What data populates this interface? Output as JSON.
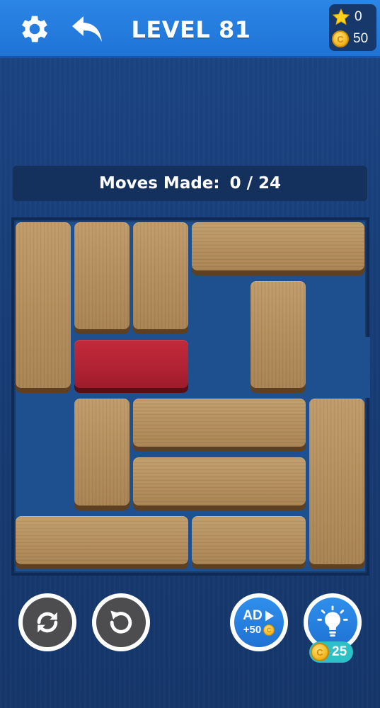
{
  "header": {
    "level_title": "LEVEL 81",
    "stars_count": "0",
    "coins_count": "50",
    "coin_symbol": "C"
  },
  "moves": {
    "label": "Moves Made:",
    "value": "0 / 24"
  },
  "buttons": {
    "settings_icon": "gear-icon",
    "back_icon": "back-arrow-icon",
    "restart_icon": "restart-icon",
    "undo_icon": "undo-icon",
    "ad_label": "AD",
    "ad_reward": "+50",
    "hint_icon": "lightbulb-icon",
    "hint_cost": "25"
  },
  "board": {
    "grid": 6,
    "goal_block_color": "#b02233",
    "wood_color": "#b48e5d"
  },
  "colors": {
    "topbar": "#2b86e6",
    "background": "#1a3f7a",
    "coin": "#f4b925",
    "hint_badge": "#2ec0c7"
  }
}
